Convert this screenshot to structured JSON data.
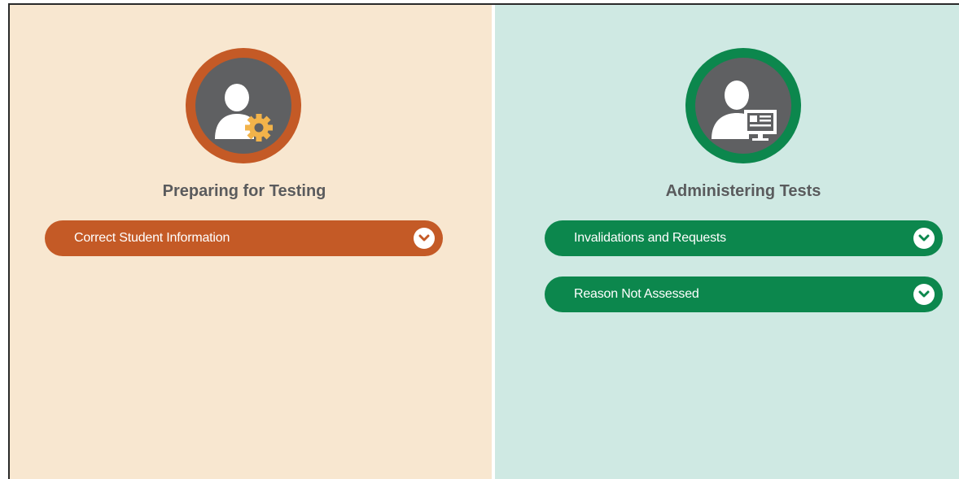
{
  "colors": {
    "left_bg": "#f8e7d0",
    "right_bg": "#cfe9e3",
    "orange": "#c45a26",
    "green": "#0c874d",
    "badge_gray": "#5f6062",
    "gear": "#f2b34a"
  },
  "left": {
    "icon": "user-gear-icon",
    "title": "Preparing for Testing",
    "items": [
      {
        "label": "Correct Student Information",
        "icon": "chevron-down-icon"
      }
    ]
  },
  "right": {
    "icon": "user-computer-icon",
    "title": "Administering Tests",
    "items": [
      {
        "label": "Invalidations and Requests",
        "icon": "chevron-down-icon"
      },
      {
        "label": "Reason Not Assessed",
        "icon": "chevron-down-icon"
      }
    ]
  }
}
